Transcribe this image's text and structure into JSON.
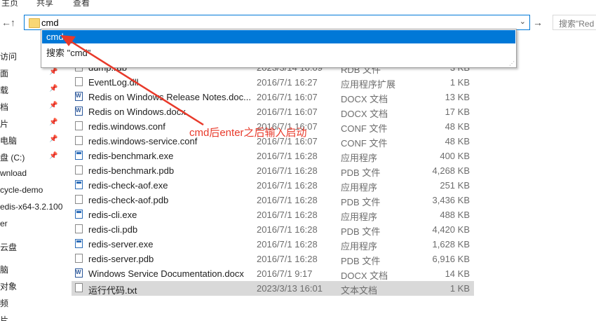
{
  "ribbon": {
    "tab1": "主页",
    "tab2": "共享",
    "tab3": "查看"
  },
  "nav": {
    "back_icon": "back-arrow-icon",
    "up_icon": "up-arrow-icon",
    "address_value": "cmd",
    "search_placeholder": "搜索\"Red"
  },
  "dropdown": {
    "items": [
      {
        "label": "cmd"
      },
      {
        "label": "搜索 \"cmd\""
      }
    ]
  },
  "sidebar": {
    "items": [
      {
        "label": "访问"
      },
      {
        "label": "面"
      },
      {
        "label": "载"
      },
      {
        "label": "档"
      },
      {
        "label": "片"
      },
      {
        "label": "电脑"
      },
      {
        "label": "盘 (C:)"
      },
      {
        "label": "wnload"
      },
      {
        "label": "cycle-demo"
      },
      {
        "label": "edis-x64-3.2.100"
      },
      {
        "label": "er"
      },
      {
        "label": "云盘"
      },
      {
        "label": "脑"
      },
      {
        "label": "对象"
      },
      {
        "label": "频"
      },
      {
        "label": "片"
      }
    ]
  },
  "files": [
    {
      "name": "dump.rdb",
      "date": "2023/3/14 16:09",
      "type": "RDB 文件",
      "size": "3 KB",
      "icon": "file-icon"
    },
    {
      "name": "EventLog.dll",
      "date": "2016/7/1 16:27",
      "type": "应用程序扩展",
      "size": "1 KB",
      "icon": "file-icon"
    },
    {
      "name": "Redis on Windows Release Notes.doc...",
      "date": "2016/7/1 16:07",
      "type": "DOCX 文档",
      "size": "13 KB",
      "icon": "word-icon"
    },
    {
      "name": "Redis on Windows.docx",
      "date": "2016/7/1 16:07",
      "type": "DOCX 文档",
      "size": "17 KB",
      "icon": "word-icon"
    },
    {
      "name": "redis.windows.conf",
      "date": "2016/7/1 16:07",
      "type": "CONF 文件",
      "size": "48 KB",
      "icon": "file-icon"
    },
    {
      "name": "redis.windows-service.conf",
      "date": "2016/7/1 16:07",
      "type": "CONF 文件",
      "size": "48 KB",
      "icon": "file-icon"
    },
    {
      "name": "redis-benchmark.exe",
      "date": "2016/7/1 16:28",
      "type": "应用程序",
      "size": "400 KB",
      "icon": "exe-icon"
    },
    {
      "name": "redis-benchmark.pdb",
      "date": "2016/7/1 16:28",
      "type": "PDB 文件",
      "size": "4,268 KB",
      "icon": "file-icon"
    },
    {
      "name": "redis-check-aof.exe",
      "date": "2016/7/1 16:28",
      "type": "应用程序",
      "size": "251 KB",
      "icon": "exe-icon"
    },
    {
      "name": "redis-check-aof.pdb",
      "date": "2016/7/1 16:28",
      "type": "PDB 文件",
      "size": "3,436 KB",
      "icon": "file-icon"
    },
    {
      "name": "redis-cli.exe",
      "date": "2016/7/1 16:28",
      "type": "应用程序",
      "size": "488 KB",
      "icon": "exe-icon"
    },
    {
      "name": "redis-cli.pdb",
      "date": "2016/7/1 16:28",
      "type": "PDB 文件",
      "size": "4,420 KB",
      "icon": "file-icon"
    },
    {
      "name": "redis-server.exe",
      "date": "2016/7/1 16:28",
      "type": "应用程序",
      "size": "1,628 KB",
      "icon": "exe-icon"
    },
    {
      "name": "redis-server.pdb",
      "date": "2016/7/1 16:28",
      "type": "PDB 文件",
      "size": "6,916 KB",
      "icon": "file-icon"
    },
    {
      "name": "Windows Service Documentation.docx",
      "date": "2016/7/1 9:17",
      "type": "DOCX 文档",
      "size": "14 KB",
      "icon": "word-icon"
    },
    {
      "name": "运行代码.txt",
      "date": "2023/3/13 16:01",
      "type": "文本文档",
      "size": "1 KB",
      "icon": "file-icon"
    }
  ],
  "annotation": {
    "text": "cmd后enter之后输入启动",
    "color": "#e8392a"
  },
  "colors": {
    "accent": "#0078d7",
    "selected_row": "#d9d9d9"
  }
}
